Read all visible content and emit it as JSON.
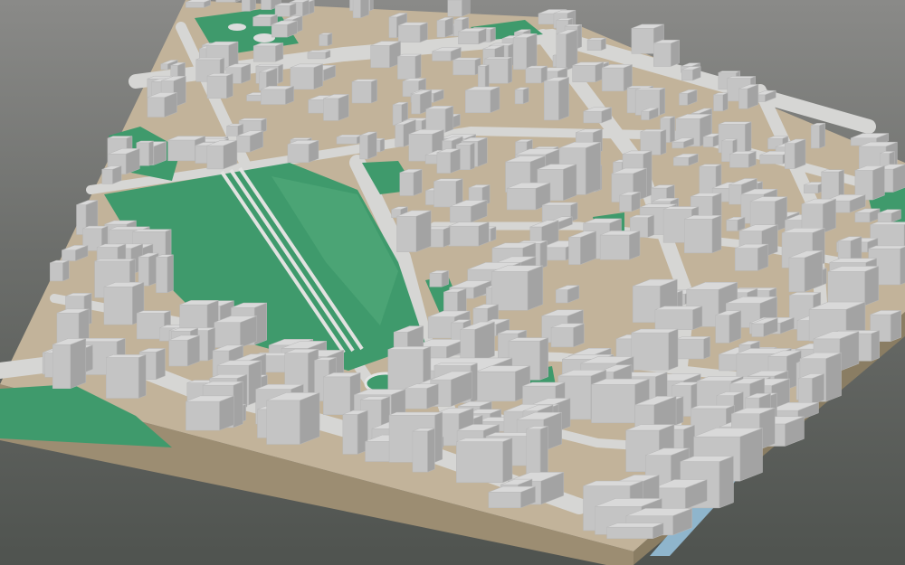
{
  "view": {
    "kind": "3d-city-block-model",
    "projection": "oblique-isometric",
    "labels_shown": false
  },
  "colors": {
    "background_top": "#8a8a88",
    "background_bottom": "#4f534f",
    "base_side": "#b9a98d",
    "base_front": "#9c8d72",
    "ground": "#c2b39a",
    "road": "#d6d6d4",
    "building_roof": "#d9d9d9",
    "building_wall_light": "#c4c4c4",
    "building_wall_dark": "#a3a3a3",
    "park": "#3f9a6c",
    "park_light": "#59ad80",
    "water": "#8fb5cc"
  },
  "features": {
    "parks": [
      "central-park",
      "north-garden",
      "west-lawn",
      "east-green-strip",
      "south-west-field"
    ],
    "water": [
      "east-river"
    ],
    "landmarks": [
      "large-hall",
      "stadium-oval",
      "park-rail-lines"
    ]
  }
}
